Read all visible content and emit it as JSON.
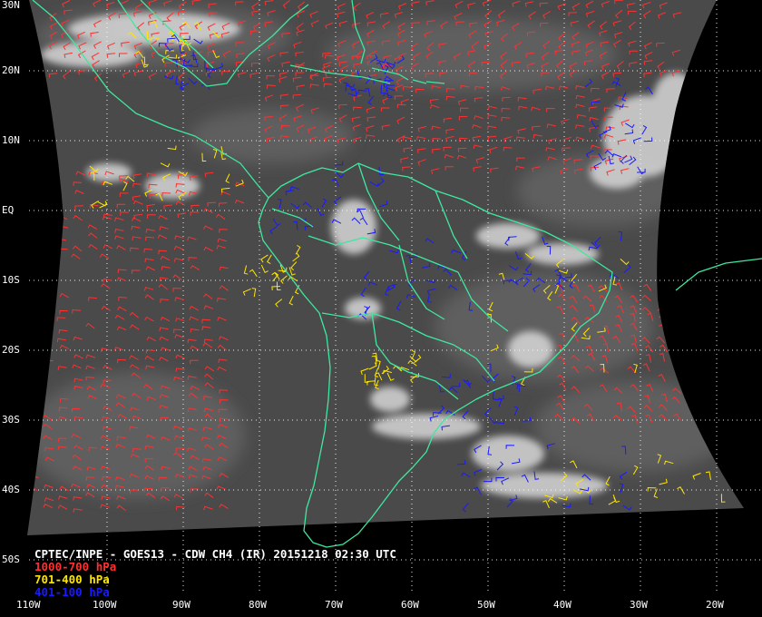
{
  "map": {
    "title": "CPTEC/INPE - GOES13 - CDW CH4 (IR) 20151218 02:30 UTC",
    "latitude_labels": [
      "30N",
      "20N",
      "10N",
      "EQ",
      "10S",
      "20S",
      "30S",
      "40S",
      "50S"
    ],
    "longitude_labels": [
      "110W",
      "100W",
      "90W",
      "80W",
      "70W",
      "60W",
      "50W",
      "40W",
      "30W",
      "20W"
    ],
    "legend": [
      {
        "label": "1000-700 hPa",
        "color": "#ff3030"
      },
      {
        "label": "701-400 hPa",
        "color": "#ffe600"
      },
      {
        "label": "401-100 hPa",
        "color": "#1a1aff"
      }
    ],
    "colors": {
      "coastline": "#3ee8a0",
      "graticule": "#ffffff",
      "background_space": "#000000",
      "imagery_base": "#4a4a4a",
      "cloud_tops": "#e6e6e6"
    }
  }
}
